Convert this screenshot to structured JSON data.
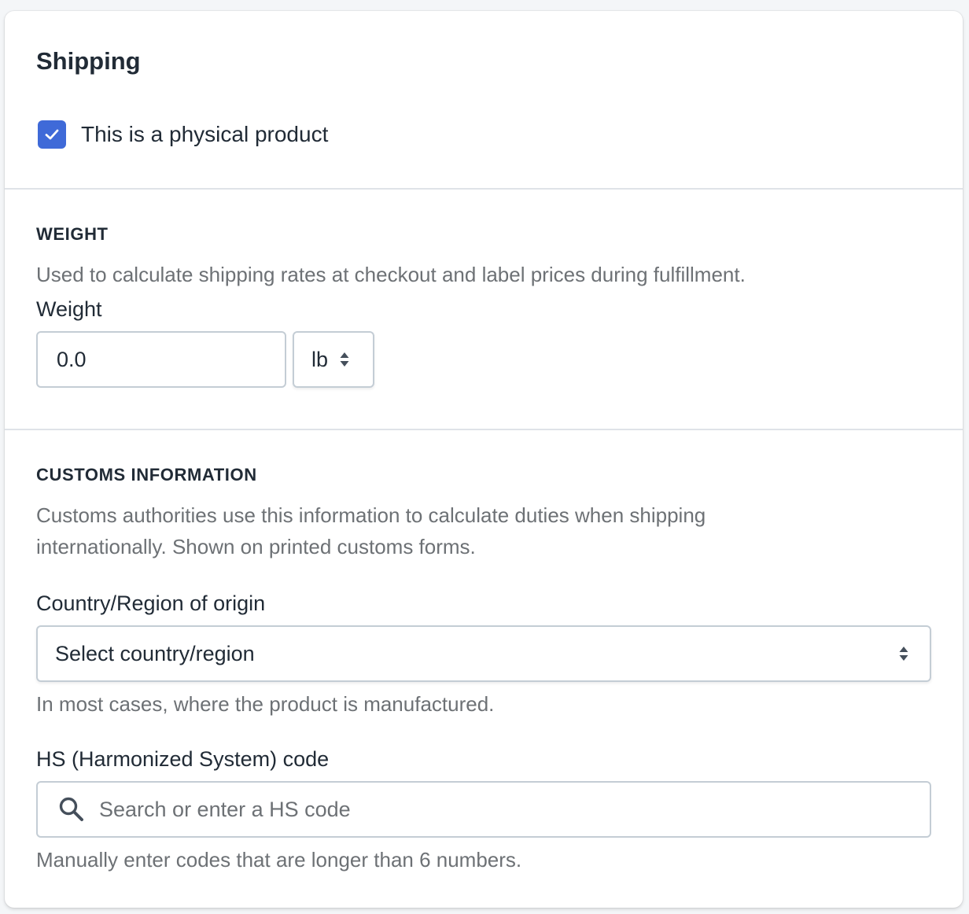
{
  "card": {
    "title": "Shipping",
    "physical_product": {
      "label": "This is a physical product",
      "checked": true
    }
  },
  "weight": {
    "heading": "WEIGHT",
    "description": "Used to calculate shipping rates at checkout and label prices during fulfillment.",
    "field_label": "Weight",
    "value": "0.0",
    "unit": "lb"
  },
  "customs": {
    "heading": "CUSTOMS INFORMATION",
    "description_line1": "Customs authorities use this information to calculate duties when shipping",
    "description_line2": "internationally. Shown on printed customs forms.",
    "origin_label": "Country/Region of origin",
    "origin_placeholder": "Select country/region",
    "origin_help": "In most cases, where the product is manufactured.",
    "hs_label": "HS (Harmonized System) code",
    "hs_placeholder": "Search or enter a HS code",
    "hs_help": "Manually enter codes that are longer than 6 numbers."
  },
  "colors": {
    "accent": "#3f6ad8",
    "border": "#c4cdd5",
    "muted_text": "#6d7175"
  },
  "icons": {
    "checkbox": "checkmark-icon",
    "select": "select-arrows-icon",
    "search": "search-icon"
  }
}
